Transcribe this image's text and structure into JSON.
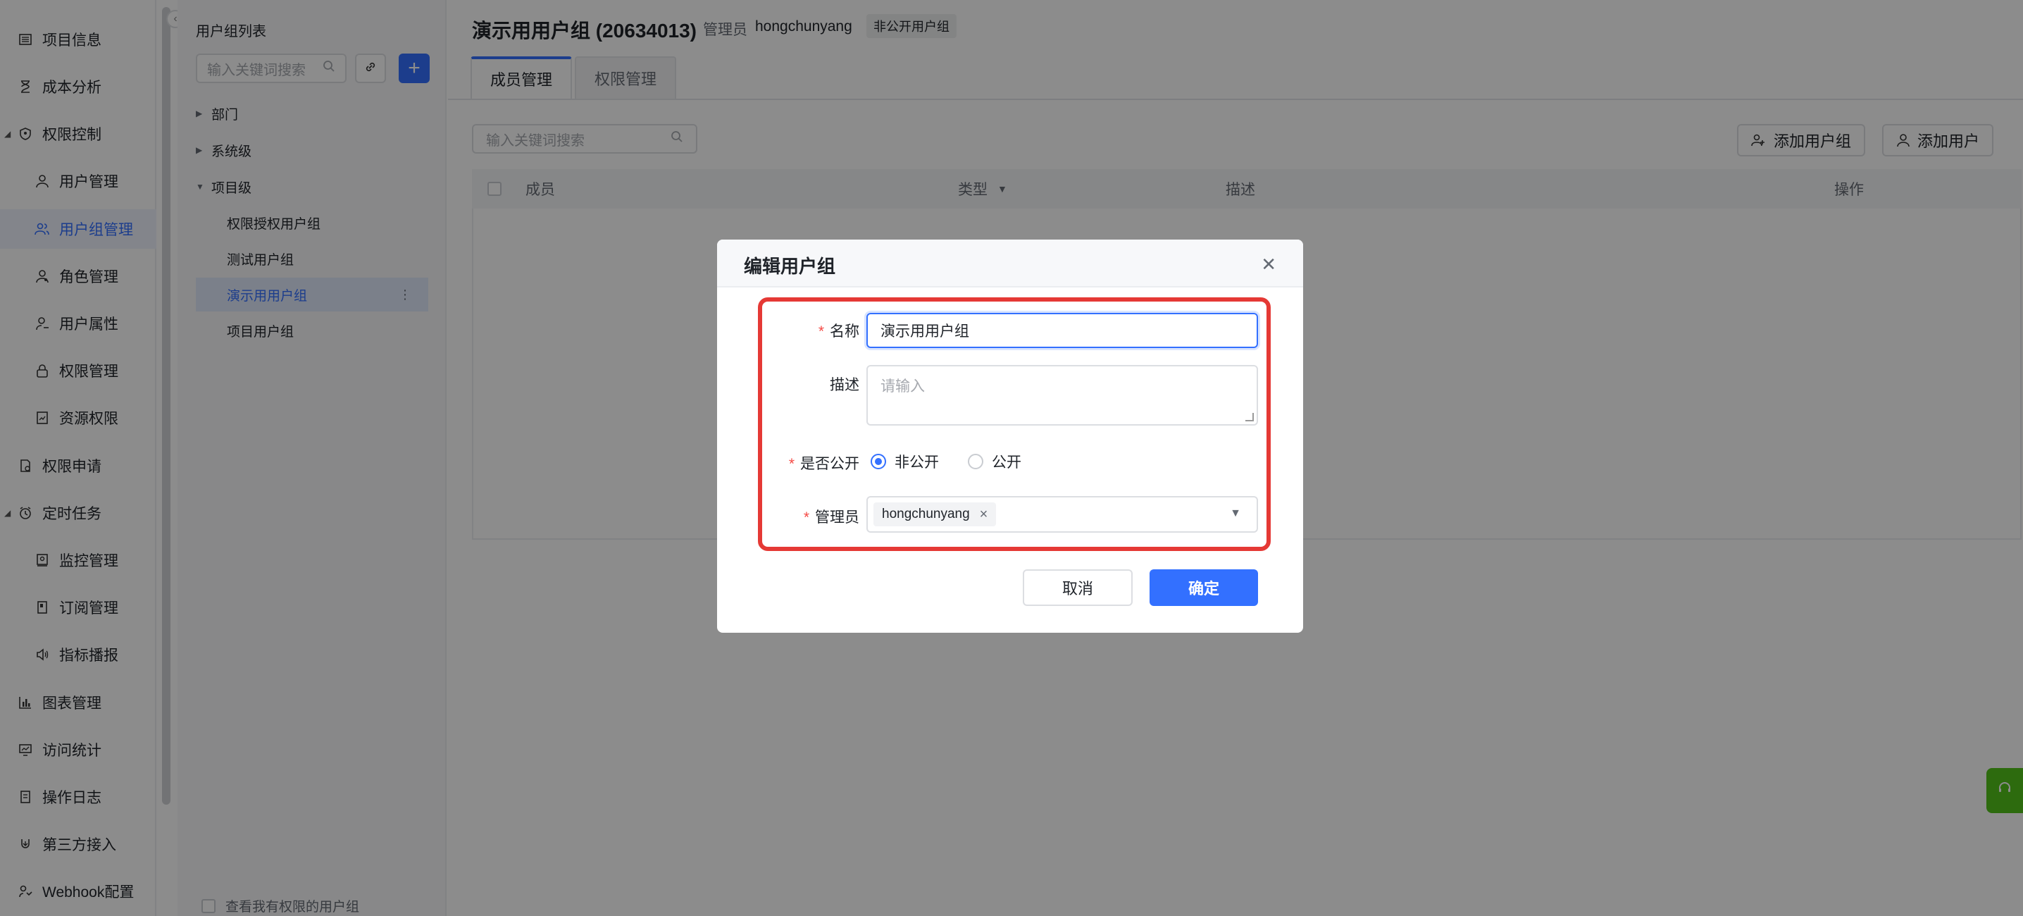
{
  "nav": {
    "items": [
      {
        "label": "项目信息",
        "icon": "list-icon"
      },
      {
        "label": "成本分析",
        "icon": "hourglass-icon"
      },
      {
        "label": "权限控制",
        "icon": "shield-icon"
      },
      {
        "label": "用户管理",
        "icon": "user-icon"
      },
      {
        "label": "用户组管理",
        "icon": "users-icon"
      },
      {
        "label": "角色管理",
        "icon": "role-icon"
      },
      {
        "label": "用户属性",
        "icon": "user-attr-icon"
      },
      {
        "label": "权限管理",
        "icon": "lock-icon"
      },
      {
        "label": "资源权限",
        "icon": "resource-icon"
      },
      {
        "label": "权限申请",
        "icon": "apply-icon"
      },
      {
        "label": "定时任务",
        "icon": "clock-icon"
      },
      {
        "label": "监控管理",
        "icon": "monitor-icon"
      },
      {
        "label": "订阅管理",
        "icon": "subscribe-icon"
      },
      {
        "label": "指标播报",
        "icon": "speaker-icon"
      },
      {
        "label": "图表管理",
        "icon": "bar-chart-icon"
      },
      {
        "label": "访问统计",
        "icon": "stats-icon"
      },
      {
        "label": "操作日志",
        "icon": "log-icon"
      },
      {
        "label": "第三方接入",
        "icon": "plug-icon"
      },
      {
        "label": "Webhook配置",
        "icon": "webhook-icon"
      }
    ]
  },
  "panel": {
    "title": "用户组列表",
    "search_placeholder": "输入关键词搜索",
    "tree": [
      {
        "label": "部门"
      },
      {
        "label": "系统级"
      },
      {
        "label": "项目级"
      },
      {
        "label": "权限授权用户组"
      },
      {
        "label": "测试用户组"
      },
      {
        "label": "演示用用户组"
      },
      {
        "label": "项目用户组"
      }
    ],
    "footer_check": "查看我有权限的用户组"
  },
  "main": {
    "title": "演示用用户组 (20634013)",
    "admin_label": "管理员",
    "admin_name": "hongchunyang",
    "badge": "非公开用户组",
    "tabs": [
      "成员管理",
      "权限管理"
    ],
    "search_placeholder": "输入关键词搜索",
    "add_group_btn": "添加用户组",
    "add_user_btn": "添加用户",
    "columns": [
      "成员",
      "类型",
      "描述",
      "操作"
    ]
  },
  "modal": {
    "title": "编辑用户组",
    "name_label": "名称",
    "name_value": "演示用用户组",
    "desc_label": "描述",
    "desc_placeholder": "请输入",
    "public_label": "是否公开",
    "option_private": "非公开",
    "option_public": "公开",
    "admin_label": "管理员",
    "admin_tag": "hongchunyang",
    "cancel": "取消",
    "ok": "确定"
  },
  "colors": {
    "accent": "#3370ff",
    "highlight": "#e53935",
    "support": "#52c41a"
  }
}
